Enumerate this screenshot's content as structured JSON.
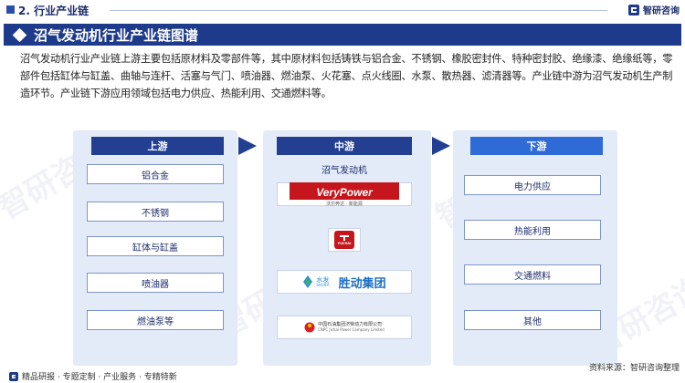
{
  "header": {
    "section_title": "2. 行业产业链",
    "brand_name": "智研咨询"
  },
  "banner": {
    "title": "沼气发动机行业产业链图谱"
  },
  "description": "沼气发动机行业产业链上游主要包括原材料及零部件等，其中原材料包括铸铁与铝合金、不锈钢、橡胶密封件、特种密封胶、绝缘漆、绝缘纸等，零部件包括缸体与缸盖、曲轴与连杆、活塞与气门、喷油器、燃油泵、火花塞、点火线圈、水泵、散热器、滤清器等。产业链中游为沼气发动机生产制造环节。产业链下游应用领域包括电力供应、热能利用、交通燃料等。",
  "watermark": "智研咨询",
  "upstream": {
    "title": "上游",
    "items": [
      "铝合金",
      "不锈钢",
      "缸体与缸盖",
      "喷油器",
      "燃油泵等"
    ]
  },
  "midstream": {
    "title": "中游",
    "label": "沼气发动机",
    "logos": {
      "verypower": "VeryPower",
      "verypower_sub": "沃尔奔达 · 新能源",
      "yuchai": "YUCHAI",
      "shuifa": "水发",
      "shuifa_en": "SHUIFA",
      "shengdong": "胜动集团",
      "cnpc": "中国石油集团济柴动力有限公司",
      "cnpc_en": "CNPC Jichai Power Company Limited"
    }
  },
  "downstream": {
    "title": "下游",
    "items": [
      "电力供应",
      "热能利用",
      "交通燃料",
      "其他"
    ]
  },
  "footer": {
    "tagline": "精品研报 · 专题定制 · 产业服务 · 专精特新",
    "source": "资料来源：智研咨询整理"
  }
}
